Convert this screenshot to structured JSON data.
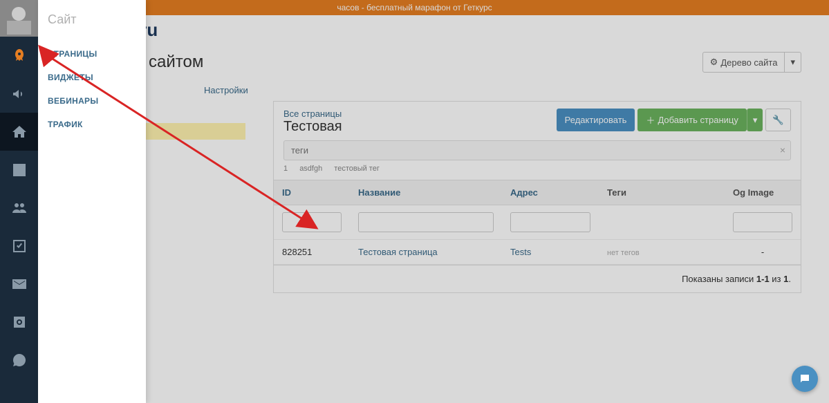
{
  "banner": {
    "text": "часов - бесплатный марафон от Геткурс"
  },
  "flyout": {
    "title": "Сайт",
    "items": [
      "СТРАНИЦЫ",
      "ВИДЖЕТЫ",
      "ВЕБИНАРЫ",
      "ТРАФИК"
    ]
  },
  "brand_suffix": ".ru",
  "page_title_part": "e сайтом",
  "tree_btn": "Дерево сайта",
  "tabs": {
    "settings": "Настройки"
  },
  "panel": {
    "breadcrumb": "Все страницы",
    "title": "Тестовая",
    "edit": "Редактировать",
    "add": "Добавить страницу",
    "tags_placeholder": "теги",
    "tag_chips": [
      "1",
      "asdfgh",
      "тестовый тег"
    ]
  },
  "table": {
    "headers": {
      "id": "ID",
      "name": "Название",
      "address": "Адрес",
      "tags": "Теги",
      "og": "Og Image"
    },
    "rows": [
      {
        "id": "828251",
        "name": "Тестовая страница",
        "address": "Tests",
        "tags": "нет тегов",
        "og": "-"
      }
    ],
    "footer_prefix": "Показаны записи ",
    "footer_range": "1-1",
    "footer_mid": " из ",
    "footer_total": "1"
  }
}
